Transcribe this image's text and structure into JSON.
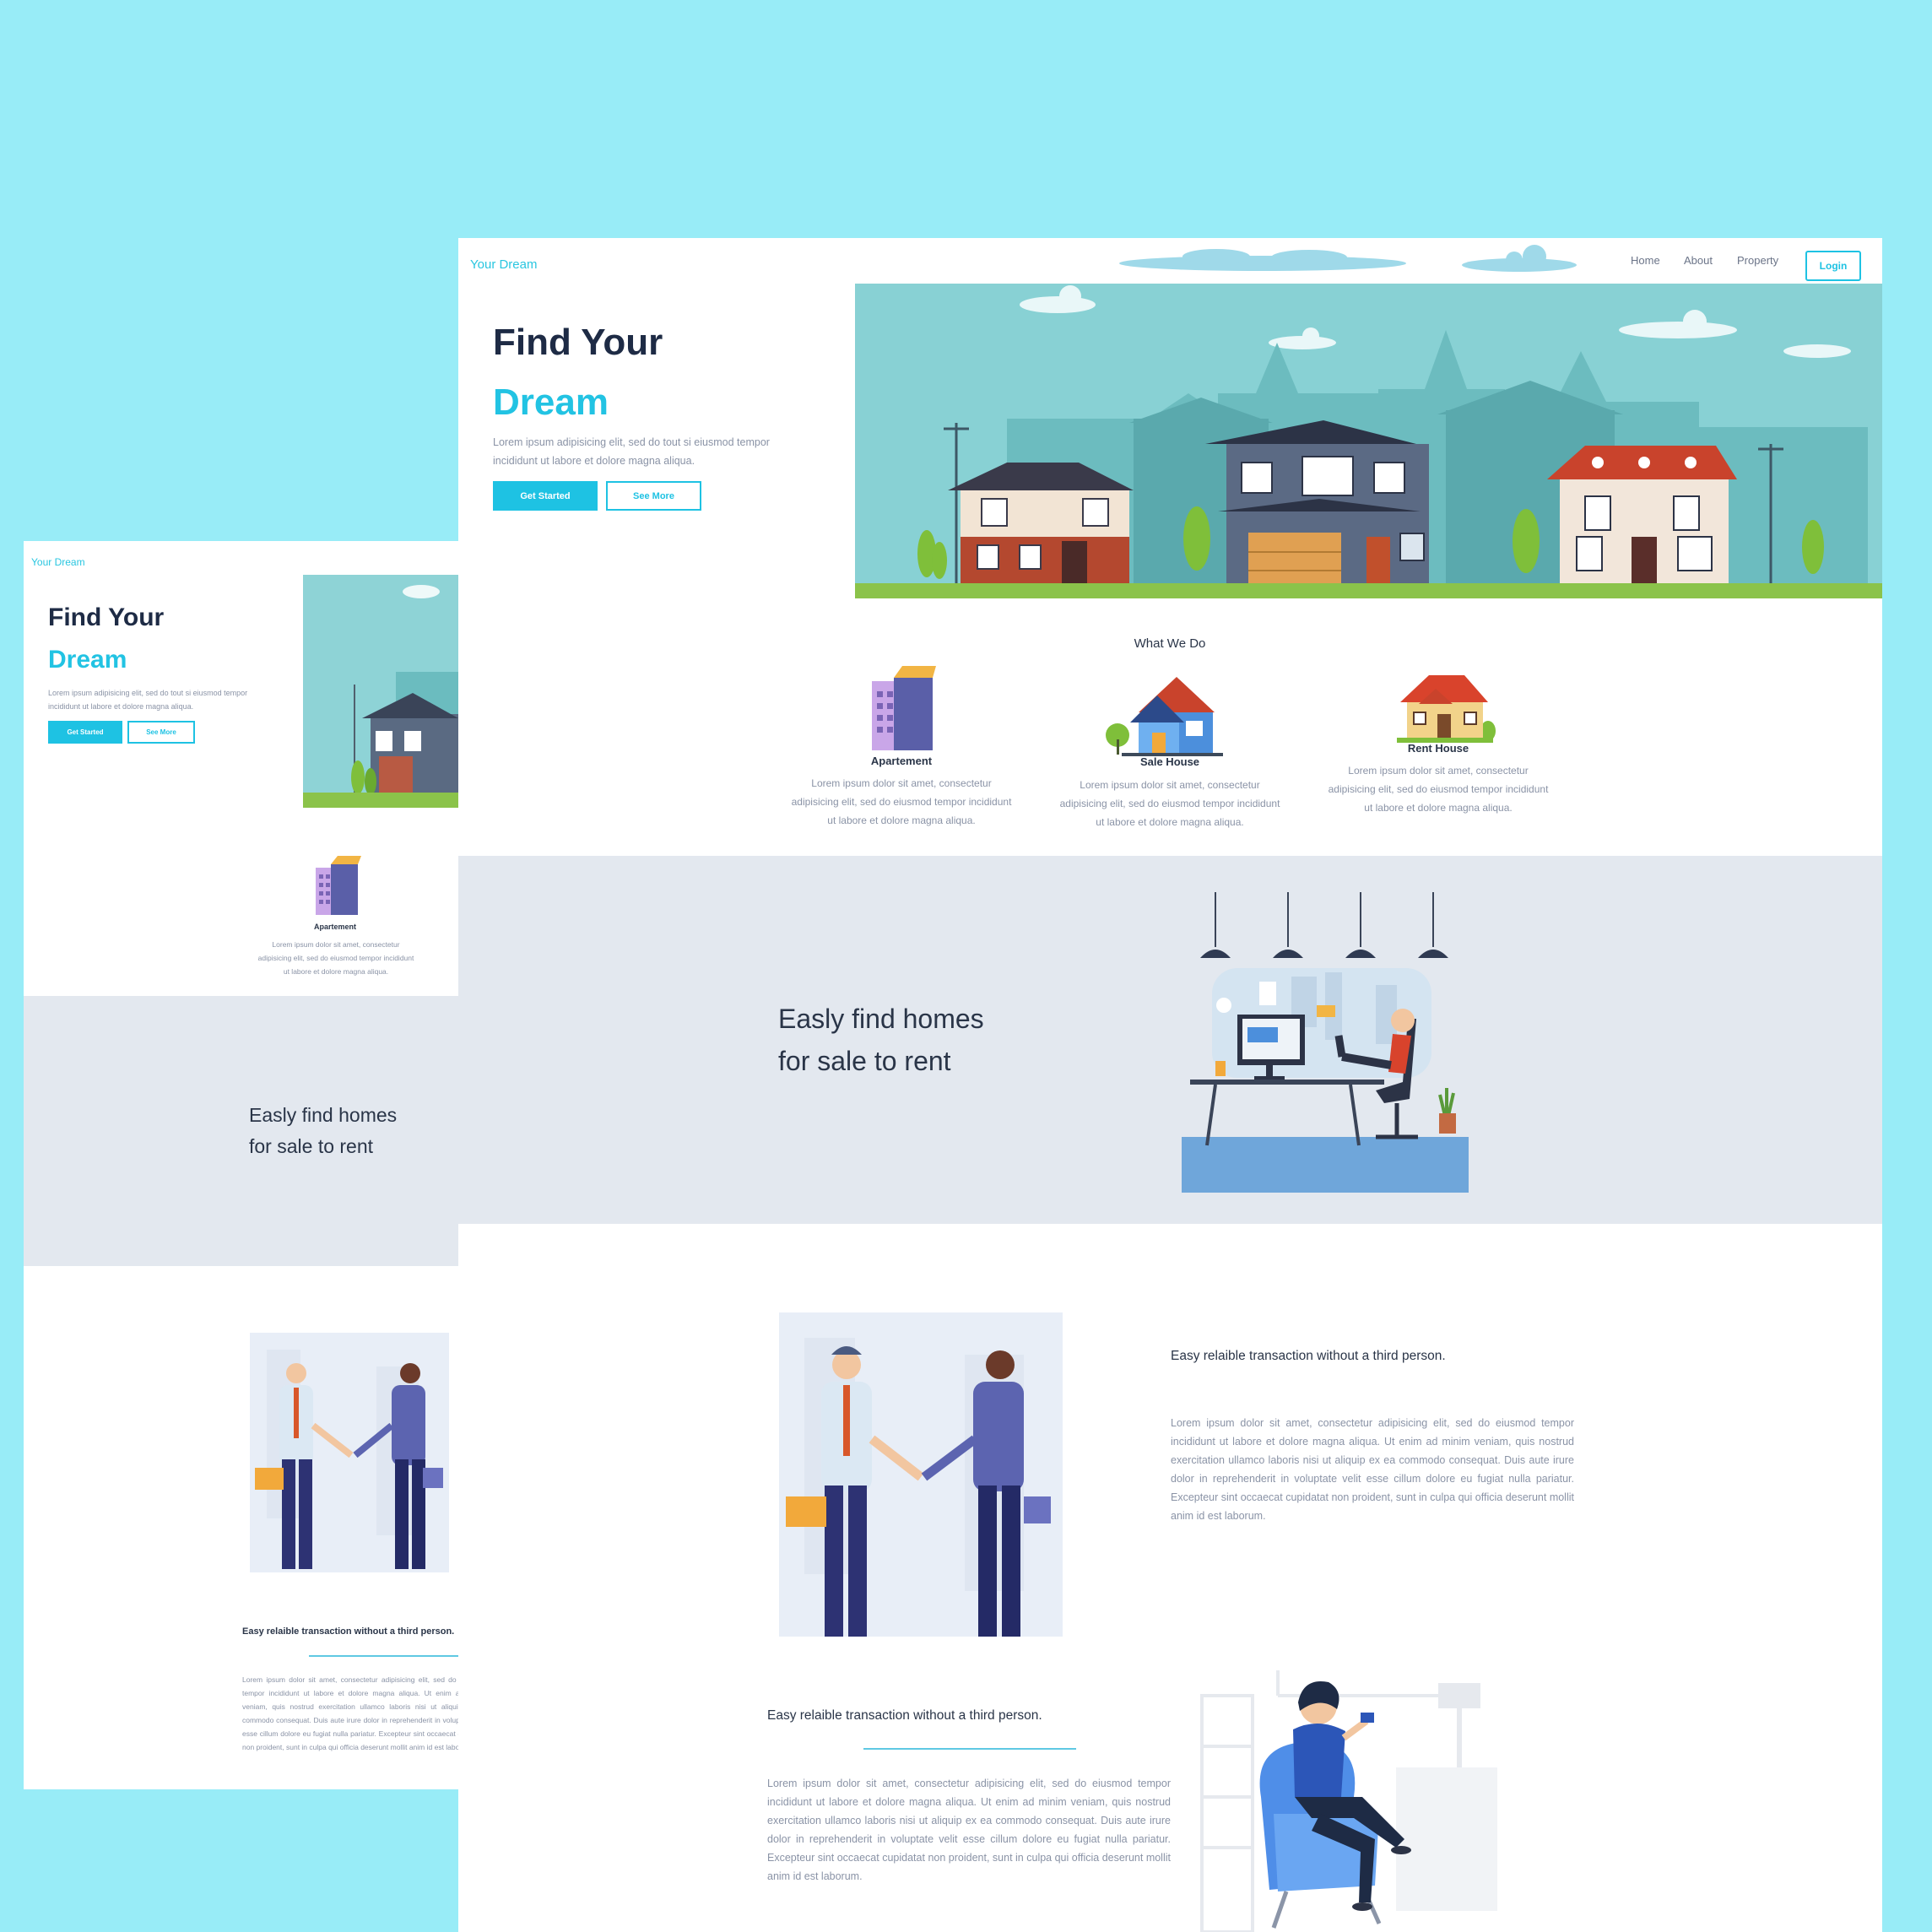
{
  "brand": "Your Dream",
  "nav": {
    "home": "Home",
    "about": "About",
    "property": "Property",
    "login": "Login"
  },
  "hero": {
    "title_line1": "Find Your",
    "title_line2": "Dream",
    "description": "Lorem ipsum adipisicing elit, sed do tout si eiusmod tempor incididunt ut labore et dolore magna aliqua.",
    "get_started": "Get Started",
    "see_more": "See More"
  },
  "services": {
    "heading": "What We Do",
    "items": [
      {
        "title": "Apartement",
        "desc": "Lorem ipsum dolor sit amet, consectetur adipisicing elit, sed do eiusmod tempor incididunt ut labore et dolore magna aliqua."
      },
      {
        "title": "Sale House",
        "desc": "Lorem ipsum dolor sit amet, consectetur adipisicing elit, sed do eiusmod tempor incididunt ut labore et dolore magna aliqua."
      },
      {
        "title": "Rent House",
        "desc": "Lorem ipsum dolor sit amet, consectetur adipisicing elit, sed do eiusmod tempor incididunt ut labore et dolore magna aliqua."
      }
    ]
  },
  "band": {
    "line1": "Easly find homes",
    "line2": "for sale to rent"
  },
  "feature": {
    "heading": "Easy relaible transaction without a third person.",
    "body": "Lorem ipsum dolor sit amet, consectetur adipisicing elit, sed do eiusmod tempor incididunt ut labore et dolore magna aliqua. Ut enim ad minim veniam, quis nostrud exercitation ullamco laboris nisi ut aliquip ex ea commodo consequat. Duis aute irure dolor in reprehenderit in voluptate velit esse cillum dolore eu fugiat nulla pariatur. Excepteur sint occaecat cupidatat non proident, sunt in culpa qui officia deserunt mollit anim id est laborum."
  },
  "colors": {
    "background": "#98ecf7",
    "accent": "#1ec2e3",
    "band": "#e3e8ef",
    "dark": "#1e2b45"
  }
}
